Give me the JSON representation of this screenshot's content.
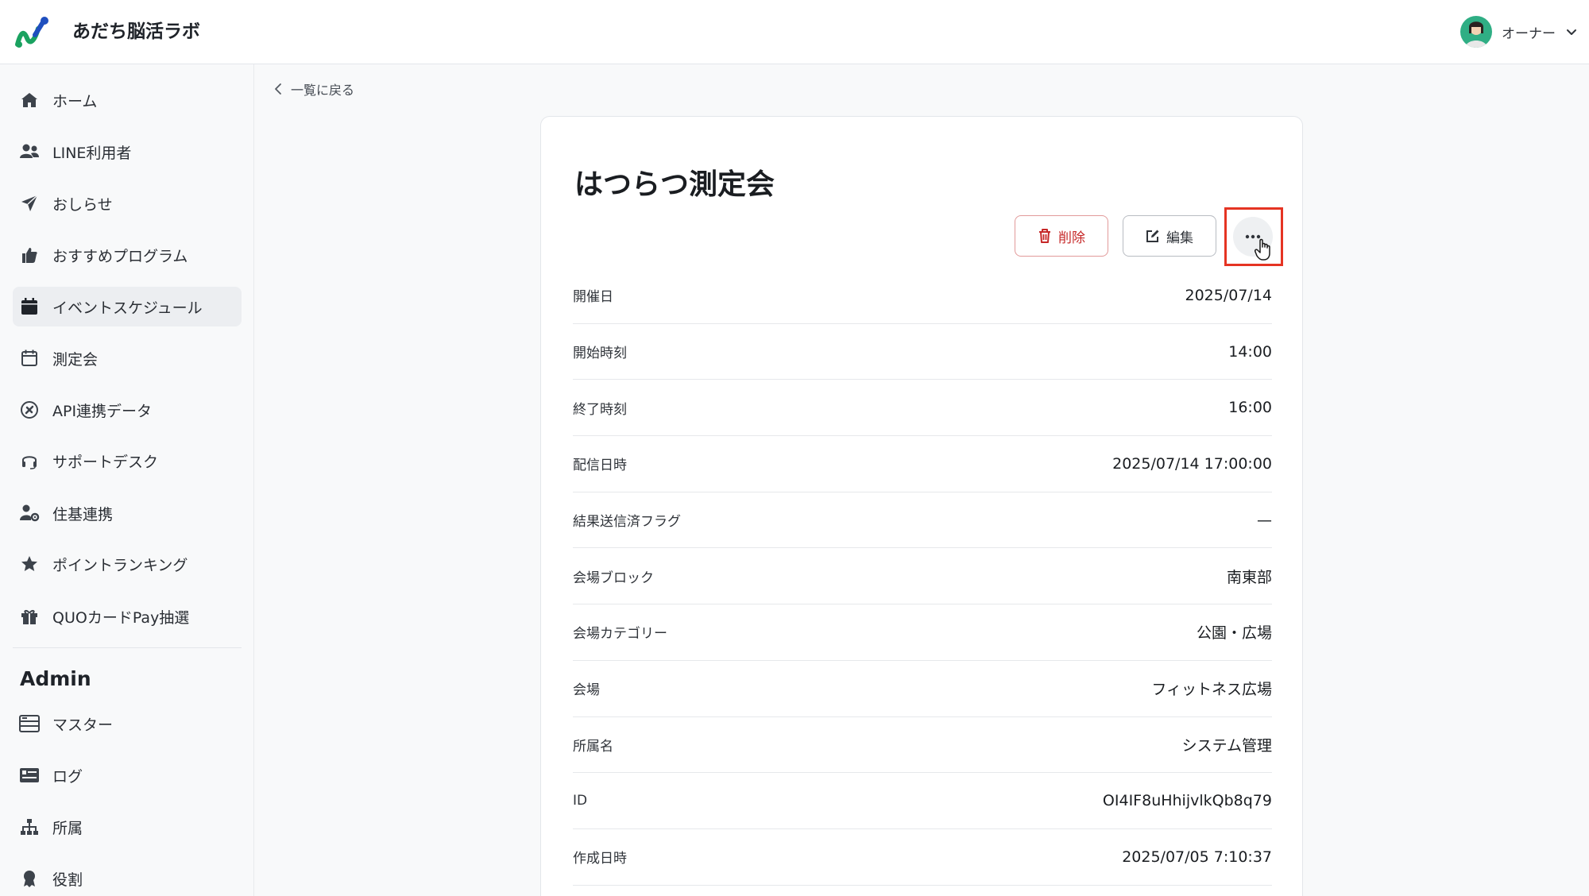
{
  "header": {
    "app_title": "あだち脳活ラボ",
    "user_name": "オーナー"
  },
  "sidebar": {
    "items": [
      {
        "label": "ホーム",
        "icon": "home-icon"
      },
      {
        "label": "LINE利用者",
        "icon": "users-icon"
      },
      {
        "label": "おしらせ",
        "icon": "paper-plane-icon"
      },
      {
        "label": "おすすめプログラム",
        "icon": "thumbs-up-icon"
      },
      {
        "label": "イベントスケジュール",
        "icon": "calendar-filled-icon",
        "active": true
      },
      {
        "label": "測定会",
        "icon": "calendar-icon"
      },
      {
        "label": "API連携データ",
        "icon": "plug-icon"
      },
      {
        "label": "サポートデスク",
        "icon": "headset-icon"
      },
      {
        "label": "住基連携",
        "icon": "user-gear-icon"
      },
      {
        "label": "ポイントランキング",
        "icon": "star-icon"
      },
      {
        "label": "QUOカードPay抽選",
        "icon": "gift-icon"
      }
    ],
    "admin_heading": "Admin",
    "admin_items": [
      {
        "label": "マスター",
        "icon": "database-icon"
      },
      {
        "label": "ログ",
        "icon": "log-icon"
      },
      {
        "label": "所属",
        "icon": "org-chart-icon"
      },
      {
        "label": "役割",
        "icon": "award-icon"
      }
    ]
  },
  "main": {
    "back_label": "一覧に戻る",
    "title": "はつらつ測定会",
    "delete_label": "削除",
    "edit_label": "編集",
    "details": [
      {
        "label": "開催日",
        "value": "2025/07/14"
      },
      {
        "label": "開始時刻",
        "value": "14:00"
      },
      {
        "label": "終了時刻",
        "value": "16:00"
      },
      {
        "label": "配信日時",
        "value": "2025/07/14 17:00:00"
      },
      {
        "label": "結果送信済フラグ",
        "value": "—"
      },
      {
        "label": "会場ブロック",
        "value": "南東部"
      },
      {
        "label": "会場カテゴリー",
        "value": "公園・広場"
      },
      {
        "label": "会場",
        "value": "フィットネス広場"
      },
      {
        "label": "所属名",
        "value": "システム管理"
      },
      {
        "label": "ID",
        "value": "OI4IF8uHhijvlkQb8q79"
      },
      {
        "label": "作成日時",
        "value": "2025/07/05 7:10:37"
      }
    ]
  },
  "colors": {
    "accent_red": "#c62828",
    "highlight_box": "#e53423",
    "logo_green": "#1aa260",
    "logo_blue": "#1f4fbf"
  }
}
